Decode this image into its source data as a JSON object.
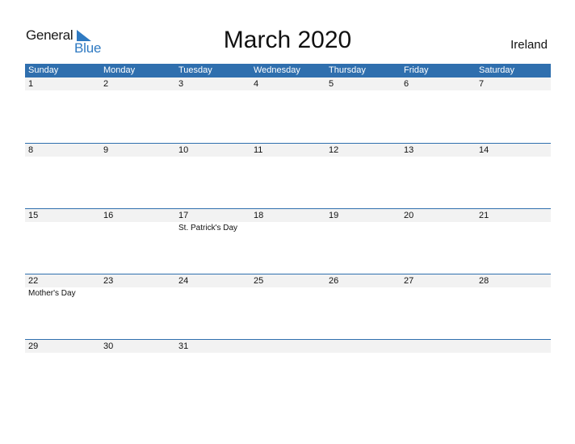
{
  "logo": {
    "general": "General",
    "blue": "Blue"
  },
  "title": "March 2020",
  "country": "Ireland",
  "weekdays": [
    "Sunday",
    "Monday",
    "Tuesday",
    "Wednesday",
    "Thursday",
    "Friday",
    "Saturday"
  ],
  "weeks": [
    {
      "days": [
        "1",
        "2",
        "3",
        "4",
        "5",
        "6",
        "7"
      ],
      "events": [
        "",
        "",
        "",
        "",
        "",
        "",
        ""
      ]
    },
    {
      "days": [
        "8",
        "9",
        "10",
        "11",
        "12",
        "13",
        "14"
      ],
      "events": [
        "",
        "",
        "",
        "",
        "",
        "",
        ""
      ]
    },
    {
      "days": [
        "15",
        "16",
        "17",
        "18",
        "19",
        "20",
        "21"
      ],
      "events": [
        "",
        "",
        "St. Patrick's Day",
        "",
        "",
        "",
        ""
      ]
    },
    {
      "days": [
        "22",
        "23",
        "24",
        "25",
        "26",
        "27",
        "28"
      ],
      "events": [
        "Mother's Day",
        "",
        "",
        "",
        "",
        "",
        ""
      ]
    },
    {
      "days": [
        "29",
        "30",
        "31",
        "",
        "",
        "",
        ""
      ],
      "events": [
        "",
        "",
        "",
        "",
        "",
        "",
        ""
      ]
    }
  ],
  "colors": {
    "header": "#2f6fae",
    "date_row": "#f2f2f2",
    "logo_blue": "#2f7ac2"
  }
}
